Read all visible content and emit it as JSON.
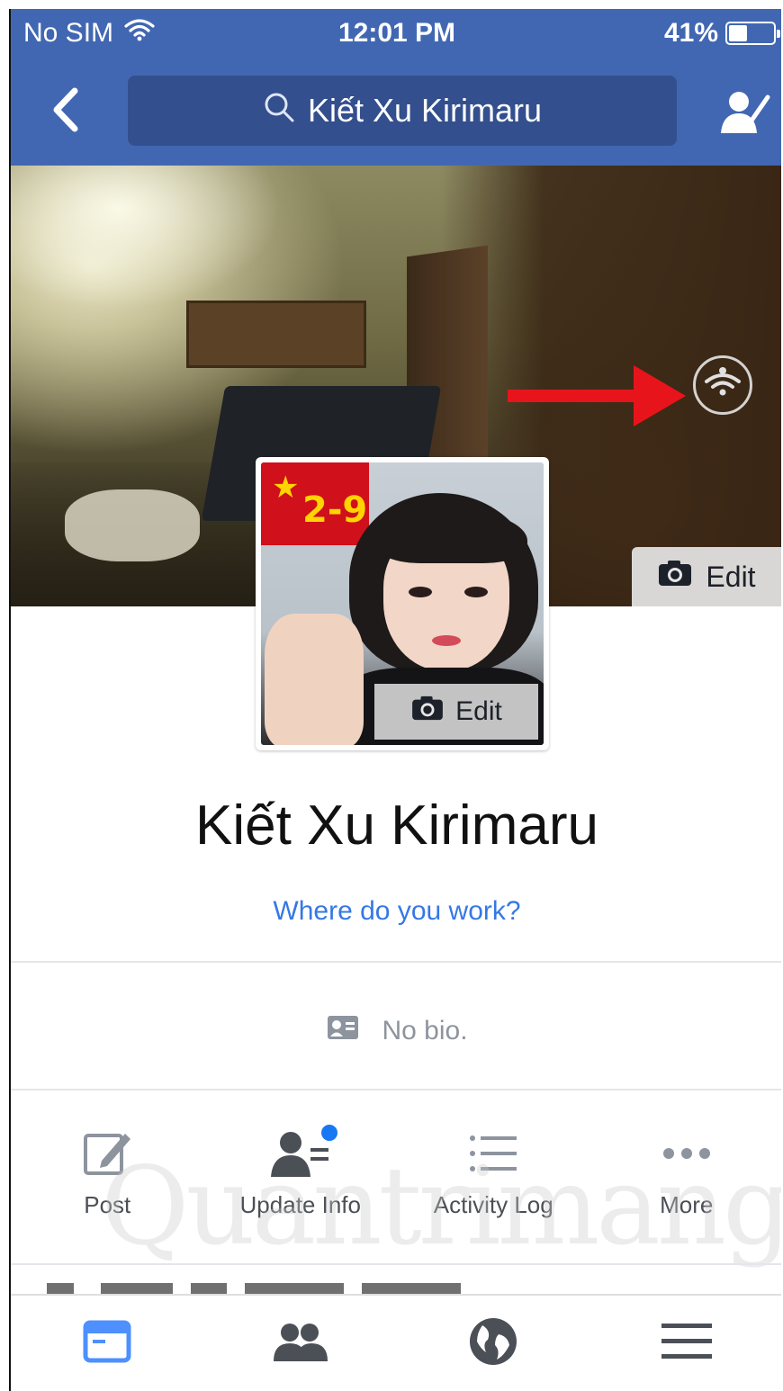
{
  "status_bar": {
    "carrier": "No SIM",
    "time": "12:01 PM",
    "battery_percent_label": "41%",
    "battery_level": 0.41
  },
  "nav_bar": {
    "search_text": "Kiết Xu Kirimaru",
    "back_icon": "chevron-left-icon",
    "search_icon": "search-icon",
    "profile_icon": "profile-edit-icon"
  },
  "cover": {
    "edit_label": "Edit",
    "privacy_icon": "wifi-globe-icon",
    "annotation_arrow_color": "#e8141b"
  },
  "avatar": {
    "edit_label": "Edit",
    "overlay_text": "2-9"
  },
  "profile": {
    "name": "Kiết Xu Kirimaru",
    "work_prompt": "Where do you work?",
    "bio_text": "No bio."
  },
  "actions": [
    {
      "label": "Post",
      "icon": "pencil-icon"
    },
    {
      "label": "Update Info",
      "icon": "person-list-icon"
    },
    {
      "label": "Activity Log",
      "icon": "list-icon"
    },
    {
      "label": "More",
      "icon": "more-dots-icon"
    }
  ],
  "tab_bar": [
    {
      "name": "news-feed",
      "icon": "news-feed-icon",
      "active": true
    },
    {
      "name": "friends",
      "icon": "friends-icon",
      "active": false
    },
    {
      "name": "notifications",
      "icon": "globe-icon",
      "active": false
    },
    {
      "name": "menu",
      "icon": "menu-icon",
      "active": false
    }
  ],
  "colors": {
    "brand_blue": "#4267b2",
    "search_bg": "#334f8d",
    "link_blue": "#3578e5",
    "active_tab": "#4d90fe",
    "inactive_tab": "#4b4f56"
  },
  "watermark_text": "Quantrimang"
}
